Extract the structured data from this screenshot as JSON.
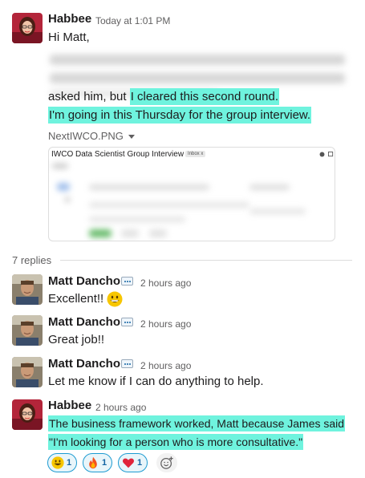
{
  "message": {
    "author": "Habbee",
    "timestamp": "Today at 1:01 PM",
    "greeting": "Hi Matt,",
    "line3_prefix": "asked him, but ",
    "line3_highlight": "I cleared this second round.",
    "line4_highlight": "I'm going in this Thursday for the group interview.",
    "attachment": {
      "filename": "NextIWCO.PNG",
      "preview_title": "IWCO Data Scientist Group Interview",
      "preview_tag": "Inbox x"
    }
  },
  "thread": {
    "replies_label": "7 replies",
    "replies": [
      {
        "author": "Matt Dancho",
        "timestamp": "2 hours ago",
        "text": "Excellent!!",
        "emoji": "grinning-face-emoji"
      },
      {
        "author": "Matt Dancho",
        "timestamp": "2 hours ago",
        "text": "Great job!!"
      },
      {
        "author": "Matt Dancho",
        "timestamp": "2 hours ago",
        "text": "Let me know if I can do anything to help."
      }
    ],
    "final": {
      "author": "Habbee",
      "timestamp": "2 hours ago",
      "line1": "The business framework worked, Matt because James said",
      "line2": "\"I'm looking for a person who is more consultative.\""
    }
  },
  "reactions": [
    {
      "icon": "grinning-face-emoji",
      "count": "1"
    },
    {
      "icon": "fire-emoji",
      "count": "1"
    },
    {
      "icon": "red-heart-emoji",
      "count": "1"
    }
  ],
  "colors": {
    "highlight": "#6ff3de",
    "reaction_border": "#1d9bd1",
    "link_blue": "#1264a3"
  }
}
